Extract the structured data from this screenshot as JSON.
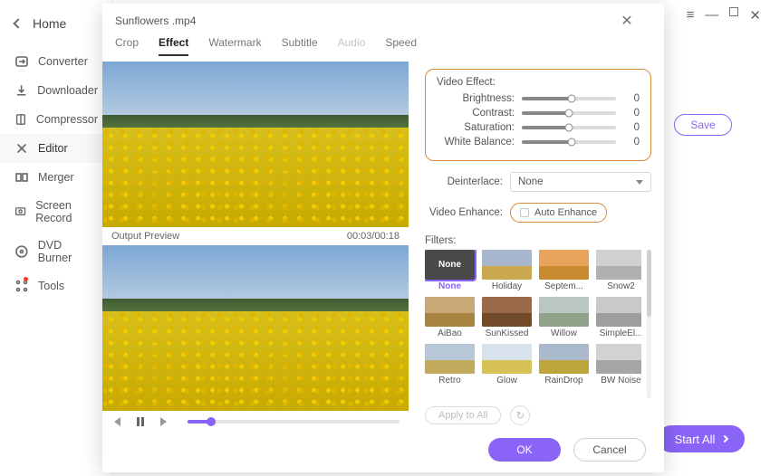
{
  "home_label": "Home",
  "sidebar": [
    {
      "label": "Converter",
      "icon": "converter-icon"
    },
    {
      "label": "Downloader",
      "icon": "downloader-icon"
    },
    {
      "label": "Compressor",
      "icon": "compressor-icon"
    },
    {
      "label": "Editor",
      "icon": "editor-icon",
      "active": true
    },
    {
      "label": "Merger",
      "icon": "merger-icon"
    },
    {
      "label": "Screen Record",
      "icon": "screen-record-icon"
    },
    {
      "label": "DVD Burner",
      "icon": "dvd-burner-icon"
    },
    {
      "label": "Tools",
      "icon": "tools-icon",
      "dot": true
    }
  ],
  "save_label": "Save",
  "start_all_label": "Start All",
  "modal": {
    "title": "Sunflowers .mp4",
    "tabs": [
      {
        "label": "Crop"
      },
      {
        "label": "Effect",
        "active": true
      },
      {
        "label": "Watermark"
      },
      {
        "label": "Subtitle"
      },
      {
        "label": "Audio",
        "disabled": true
      },
      {
        "label": "Speed"
      }
    ],
    "output_preview_label": "Output Preview",
    "time": "00:03/00:18",
    "panel": {
      "video_effect_label": "Video Effect:",
      "sliders": [
        {
          "label": "Brightness:",
          "value": 0,
          "percent": 53
        },
        {
          "label": "Contrast:",
          "value": 0,
          "percent": 50
        },
        {
          "label": "Saturation:",
          "value": 0,
          "percent": 50
        },
        {
          "label": "White Balance:",
          "value": 0,
          "percent": 53
        }
      ],
      "deinterlace_label": "Deinterlace:",
      "deinterlace_value": "None",
      "video_enhance_label": "Video Enhance:",
      "auto_enhance_label": "Auto Enhance",
      "filters_label": "Filters:",
      "filters": [
        {
          "name": "None",
          "none": true,
          "selected": true
        },
        {
          "name": "Holiday",
          "sky": "#a7b6cc",
          "field": "#caa84e"
        },
        {
          "name": "Septem...",
          "sky": "#e9a35a",
          "field": "#c88a2f"
        },
        {
          "name": "Snow2",
          "sky": "#d0d0d0",
          "field": "#b0b0b0"
        },
        {
          "name": "AiBao",
          "sky": "#c7a876",
          "field": "#a88441"
        },
        {
          "name": "SunKissed",
          "sky": "#9a6a4a",
          "field": "#714a2a"
        },
        {
          "name": "Willow",
          "sky": "#b9c6c2",
          "field": "#8fa28a"
        },
        {
          "name": "SimpleEl...",
          "sky": "#c9c9c9",
          "field": "#9e9e9e"
        },
        {
          "name": "Retro",
          "sky": "#b7c7d8",
          "field": "#c2ab5c"
        },
        {
          "name": "Glow",
          "sky": "#d8e2ec",
          "field": "#d7c258"
        },
        {
          "name": "RainDrop",
          "sky": "#aab9cc",
          "field": "#bda53c"
        },
        {
          "name": "BW Noise",
          "sky": "#d2d2d2",
          "field": "#a5a5a5"
        }
      ],
      "apply_label": "Apply to All"
    },
    "ok_label": "OK",
    "cancel_label": "Cancel"
  }
}
